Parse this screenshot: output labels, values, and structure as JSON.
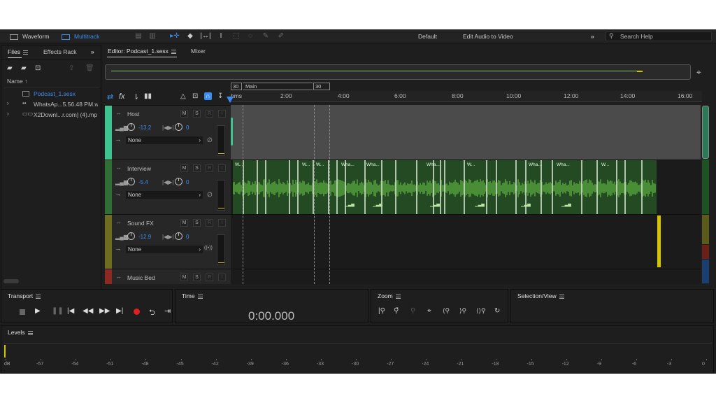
{
  "workspace_tabs": {
    "waveform": "Waveform",
    "multitrack": "Multitrack"
  },
  "workspaces": {
    "default": "Default",
    "edit_video": "Edit Audio to Video"
  },
  "search": {
    "placeholder": "Search Help"
  },
  "files_panel": {
    "tabs": [
      "Files",
      "Effects Rack"
    ],
    "name_header": "Name",
    "items": [
      {
        "name": "Podcast_1.sesx",
        "selected": true
      },
      {
        "name": "WhatsAp...5.56.48 PM.w"
      },
      {
        "name": "X2Downl...r.com] (4).mp"
      }
    ]
  },
  "editor": {
    "tab_label": "Editor: Podcast_1.sesx",
    "mixer_label": "Mixer",
    "ruler": {
      "labels": [
        "hms",
        "2:00",
        "4:00",
        "6:00",
        "8:00",
        "10:00",
        "12:00",
        "14:00",
        "16:00"
      ]
    },
    "markers": {
      "start": "30",
      "main": "Main",
      "end": "30"
    }
  },
  "tracks": [
    {
      "name": "Host",
      "volume": "-13.2",
      "pan": "0",
      "output": "None",
      "color": "#3ec28f"
    },
    {
      "name": "Interview",
      "volume": "-5.4",
      "pan": "0",
      "output": "None",
      "color": "#2f6e34"
    },
    {
      "name": "Sound FX",
      "volume": "-12.9",
      "pan": "0",
      "output": "None",
      "color": "#6e6c1e"
    },
    {
      "name": "Music Bed",
      "color": "#8a2a22"
    }
  ],
  "track_buttons": {
    "mute": "M",
    "solo": "S",
    "arm": "R",
    "input": "I"
  },
  "clip_label": "Wha...",
  "clip_label_short": "W...",
  "transport": {
    "title": "Transport"
  },
  "time_panel": {
    "title": "Time",
    "value": "0:00.000"
  },
  "zoom_panel": {
    "title": "Zoom"
  },
  "selection_panel": {
    "title": "Selection/View"
  },
  "levels": {
    "title": "Levels",
    "scale": [
      "dB",
      "-57",
      "-54",
      "-51",
      "-48",
      "-45",
      "-42",
      "-39",
      "-36",
      "-33",
      "-30",
      "-27",
      "-24",
      "-21",
      "-18",
      "-15",
      "-12",
      "-9",
      "-6",
      "-3",
      "0"
    ]
  }
}
